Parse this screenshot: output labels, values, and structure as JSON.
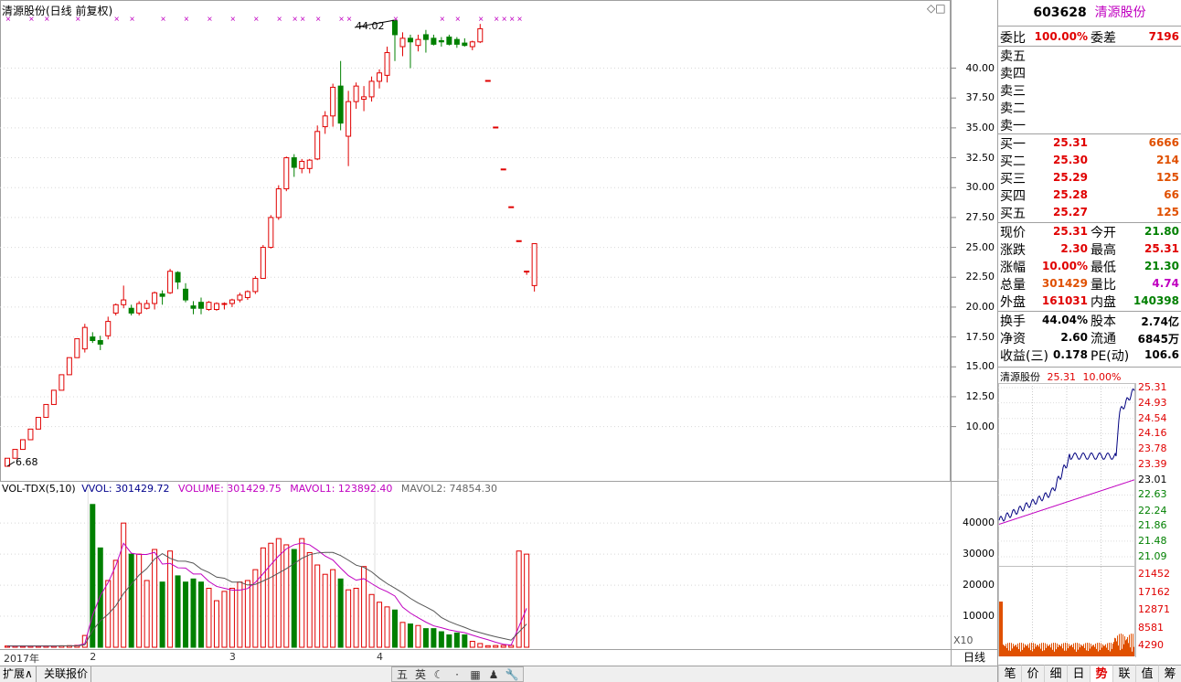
{
  "chart": {
    "title": "清源股份(日线 前复权)",
    "high_marker": "44.02",
    "low_marker": "6.68",
    "price_axis": [
      "40.00",
      "37.50",
      "35.00",
      "32.50",
      "30.00",
      "27.50",
      "25.00",
      "22.50",
      "20.00",
      "17.50",
      "15.00",
      "12.50",
      "10.00"
    ],
    "date_labels": [
      "2017年",
      "2",
      "3",
      "4"
    ],
    "period_label": "日线",
    "x10_label": "X10",
    "corner_icons": "◇□"
  },
  "volume_header": {
    "indicator": "VOL-TDX(5,10)",
    "vvol": "VVOL: 301429.72",
    "volume": "VOLUME: 301429.75",
    "mavol1": "MAVOL1: 123892.40",
    "mavol2": "MAVOL2: 74854.30",
    "axis": [
      "40000",
      "30000",
      "20000",
      "10000"
    ]
  },
  "bottom_tabs": {
    "expand": "扩展∧",
    "related_quotes": "关联报价"
  },
  "toolbar_icons": [
    "五",
    "英",
    "☾",
    "⋅",
    "▦",
    "♟",
    "🔧"
  ],
  "quote": {
    "code": "603628",
    "name": "清源股份",
    "weibi_label": "委比",
    "weibi_value": "100.00%",
    "weicha_label": "委差",
    "weicha_value": "7196",
    "sell_levels": [
      {
        "label": "卖五",
        "price": "",
        "vol": ""
      },
      {
        "label": "卖四",
        "price": "",
        "vol": ""
      },
      {
        "label": "卖三",
        "price": "",
        "vol": ""
      },
      {
        "label": "卖二",
        "price": "",
        "vol": ""
      },
      {
        "label": "卖一",
        "price": "",
        "vol": ""
      }
    ],
    "buy_levels": [
      {
        "label": "买一",
        "price": "25.31",
        "vol": "6666"
      },
      {
        "label": "买二",
        "price": "25.30",
        "vol": "214"
      },
      {
        "label": "买三",
        "price": "25.29",
        "vol": "125"
      },
      {
        "label": "买四",
        "price": "25.28",
        "vol": "66"
      },
      {
        "label": "买五",
        "price": "25.27",
        "vol": "125"
      }
    ],
    "stats1": [
      {
        "l1": "现价",
        "v1": "25.31",
        "l2": "今开",
        "v2": "21.80"
      },
      {
        "l1": "涨跌",
        "v1": "2.30",
        "l2": "最高",
        "v2": "25.31"
      },
      {
        "l1": "涨幅",
        "v1": "10.00%",
        "l2": "最低",
        "v2": "21.30"
      },
      {
        "l1": "总量",
        "v1": "301429",
        "l2": "量比",
        "v2": "4.74"
      },
      {
        "l1": "外盘",
        "v1": "161031",
        "l2": "内盘",
        "v2": "140398"
      }
    ],
    "stats2": [
      {
        "l1": "换手",
        "v1": "44.04%",
        "l2": "股本",
        "v2": "2.74亿"
      },
      {
        "l1": "净资",
        "v1": "2.60",
        "l2": "流通",
        "v2": "6845万"
      },
      {
        "l1": "收益(三)",
        "v1": "0.178",
        "l2": "PE(动)",
        "v2": "106.6"
      }
    ]
  },
  "mini": {
    "name": "清源股份",
    "price": "25.31",
    "pct": "10.00%",
    "price_axis": [
      "25.31",
      "24.93",
      "24.54",
      "24.16",
      "23.78",
      "23.39",
      "23.01",
      "22.63",
      "22.24",
      "21.86",
      "21.48",
      "21.09"
    ],
    "vol_axis": [
      "21452",
      "17162",
      "12871",
      "8581",
      "4290"
    ]
  },
  "right_tabs": [
    "笔",
    "价",
    "细",
    "日",
    "势",
    "联",
    "值",
    "筹"
  ],
  "colors": {
    "up": "#e00000",
    "down": "#008000",
    "accent": "#c000c0"
  },
  "chart_data": {
    "type": "candlestick",
    "price_ylim": [
      6.68,
      44.02
    ],
    "candles": [
      [
        6.68,
        7.35,
        6.68,
        7.35
      ],
      [
        7.35,
        8.09,
        7.35,
        8.09
      ],
      [
        8.09,
        8.9,
        8.09,
        8.9
      ],
      [
        8.9,
        9.79,
        8.9,
        9.79
      ],
      [
        9.79,
        10.77,
        9.79,
        10.77
      ],
      [
        10.77,
        11.85,
        10.77,
        11.85
      ],
      [
        11.85,
        13.04,
        11.85,
        13.04
      ],
      [
        13.04,
        14.34,
        13.04,
        14.34
      ],
      [
        14.34,
        15.77,
        14.34,
        15.77
      ],
      [
        15.77,
        17.35,
        15.77,
        17.35
      ],
      [
        16.5,
        18.6,
        16.2,
        18.3
      ],
      [
        17.5,
        17.9,
        17.0,
        17.2
      ],
      [
        17.2,
        17.6,
        16.4,
        16.9
      ],
      [
        17.6,
        19.2,
        17.3,
        18.8
      ],
      [
        19.5,
        20.3,
        19.3,
        20.2
      ],
      [
        20.2,
        21.8,
        19.9,
        20.6
      ],
      [
        19.9,
        20.2,
        19.3,
        19.5
      ],
      [
        19.5,
        20.5,
        19.3,
        20.3
      ],
      [
        19.9,
        20.6,
        19.8,
        20.3
      ],
      [
        20.3,
        21.3,
        19.8,
        21.2
      ],
      [
        21.1,
        21.4,
        20.2,
        20.9
      ],
      [
        21.2,
        23.2,
        21.1,
        23.0
      ],
      [
        22.9,
        23.0,
        21.5,
        22.1
      ],
      [
        21.5,
        22.0,
        20.4,
        20.6
      ],
      [
        20.1,
        20.5,
        19.4,
        19.9
      ],
      [
        20.4,
        20.8,
        19.4,
        19.9
      ],
      [
        19.8,
        20.5,
        19.7,
        20.4
      ],
      [
        19.8,
        20.4,
        19.7,
        20.3
      ],
      [
        20.3,
        20.4,
        19.8,
        20.3
      ],
      [
        20.3,
        20.7,
        20.0,
        20.6
      ],
      [
        20.6,
        21.2,
        20.4,
        21.0
      ],
      [
        20.8,
        21.4,
        20.6,
        21.3
      ],
      [
        21.3,
        22.6,
        21.1,
        22.4
      ],
      [
        22.4,
        25.2,
        22.4,
        25.0
      ],
      [
        25.0,
        27.7,
        24.9,
        27.5
      ],
      [
        27.5,
        30.2,
        27.3,
        29.9
      ],
      [
        29.9,
        32.6,
        29.7,
        32.5
      ],
      [
        32.5,
        32.8,
        30.9,
        31.7
      ],
      [
        31.6,
        32.4,
        31.2,
        32.2
      ],
      [
        31.6,
        32.4,
        31.2,
        32.3
      ],
      [
        32.4,
        35.2,
        32.3,
        34.7
      ],
      [
        35.1,
        36.4,
        34.5,
        36.0
      ],
      [
        36.0,
        38.7,
        35.1,
        38.4
      ],
      [
        38.5,
        40.6,
        34.8,
        35.4
      ],
      [
        34.3,
        38.1,
        31.8,
        37.2
      ],
      [
        37.2,
        38.8,
        36.6,
        38.5
      ],
      [
        37.4,
        38.5,
        36.4,
        37.6
      ],
      [
        37.6,
        39.3,
        37.2,
        38.9
      ],
      [
        38.9,
        39.9,
        38.3,
        39.6
      ],
      [
        39.4,
        41.8,
        38.8,
        41.3
      ],
      [
        44.0,
        44.02,
        40.6,
        42.8
      ],
      [
        41.8,
        43.0,
        41.0,
        42.5
      ],
      [
        42.5,
        42.8,
        40.0,
        42.2
      ],
      [
        41.9,
        42.8,
        41.4,
        42.4
      ],
      [
        42.8,
        43.2,
        41.3,
        42.4
      ],
      [
        42.5,
        42.8,
        41.9,
        42.0
      ],
      [
        42.3,
        42.6,
        41.8,
        42.2
      ],
      [
        42.6,
        42.8,
        41.9,
        42.0
      ],
      [
        42.4,
        42.6,
        41.7,
        42.0
      ],
      [
        42.1,
        42.5,
        41.8,
        41.9
      ],
      [
        41.8,
        42.3,
        41.5,
        42.2
      ],
      [
        42.2,
        43.7,
        42.1,
        43.3
      ],
      [
        38.97,
        38.97,
        38.97,
        38.97
      ],
      [
        35.07,
        35.07,
        35.07,
        35.07
      ],
      [
        31.56,
        31.56,
        31.56,
        31.56
      ],
      [
        28.4,
        28.4,
        28.4,
        28.4
      ],
      [
        25.56,
        25.56,
        25.56,
        25.56
      ],
      [
        23.01,
        23.01,
        22.7,
        23.01
      ],
      [
        21.8,
        25.31,
        21.3,
        25.31
      ]
    ],
    "volumes": [
      400,
      420,
      380,
      420,
      410,
      450,
      430,
      480,
      520,
      620,
      3800,
      46000,
      32000,
      21500,
      28000,
      40000,
      30000,
      30000,
      21500,
      31500,
      21000,
      31000,
      23000,
      21000,
      22000,
      21000,
      19000,
      15000,
      18000,
      19000,
      21000,
      21500,
      25000,
      32000,
      33500,
      35000,
      33000,
      31500,
      35000,
      30500,
      26500,
      23500,
      25000,
      22000,
      18500,
      19000,
      26000,
      17000,
      14500,
      13000,
      12000,
      8000,
      7500,
      7000,
      6000,
      6000,
      5000,
      4000,
      4600,
      4000,
      1900,
      1200,
      500,
      550,
      600,
      600,
      31000,
      30000
    ],
    "volume_ylim": [
      0,
      48000
    ],
    "mini_ylim": [
      21.09,
      25.31
    ]
  }
}
